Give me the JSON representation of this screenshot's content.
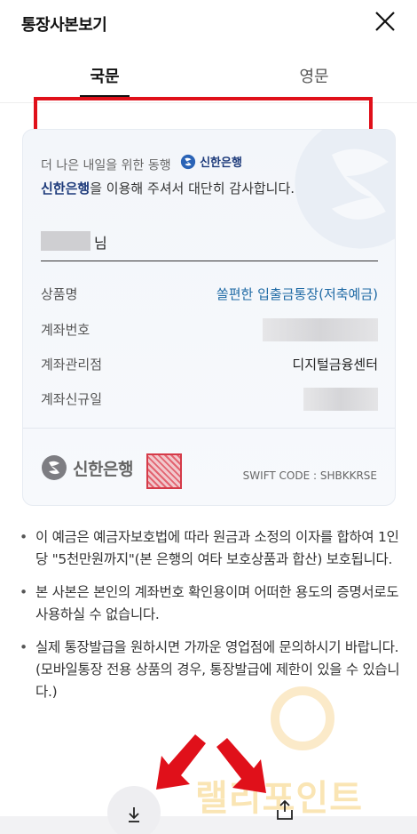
{
  "header": {
    "title": "통장사본보기",
    "close_icon": "close-icon"
  },
  "tabs": [
    {
      "label": "국문",
      "active": true
    },
    {
      "label": "영문",
      "active": false
    }
  ],
  "card": {
    "greeting_line1": "더 나은 내일을 위한 동행",
    "brand_small": "신한은행",
    "greeting_bank": "신한은행",
    "greeting_rest": "을 이용해 주셔서 대단히 감사합니다.",
    "name_suffix": "님",
    "rows": [
      {
        "label": "상품명",
        "value": "쏠편한 입출금통장(저축예금)"
      },
      {
        "label": "계좌번호",
        "value": ""
      },
      {
        "label": "계좌관리점",
        "value": "디지털금융센터"
      },
      {
        "label": "계좌신규일",
        "value": ""
      }
    ],
    "footer_logo_text": "신한은행",
    "swift": "SWIFT CODE : SHBKKRSE"
  },
  "notes": [
    "이 예금은 예금자보호법에 따라 원금과 소정의 이자를 합하여 1인당 \"5천만원까지\"(본 은행의 여타 보호상품과 합산) 보호됩니다.",
    "본 사본은 본인의 계좌번호 확인용이며 어떠한 용도의 증명서로도 사용하실 수 없습니다.",
    "실제 통장발급을 원하시면 가까운 영업점에 문의하시기 바랍니다.(모바일통장 전용 상품의 경우, 통장발급에 제한이 있을 수 있습니다.)"
  ],
  "watermark_text": "랠리포인트",
  "colors": {
    "accent": "#1f6aa5",
    "brand": "#1d3a7a",
    "highlight": "#e0101a"
  },
  "actions": {
    "download_icon": "download-icon",
    "share_icon": "share-icon"
  }
}
